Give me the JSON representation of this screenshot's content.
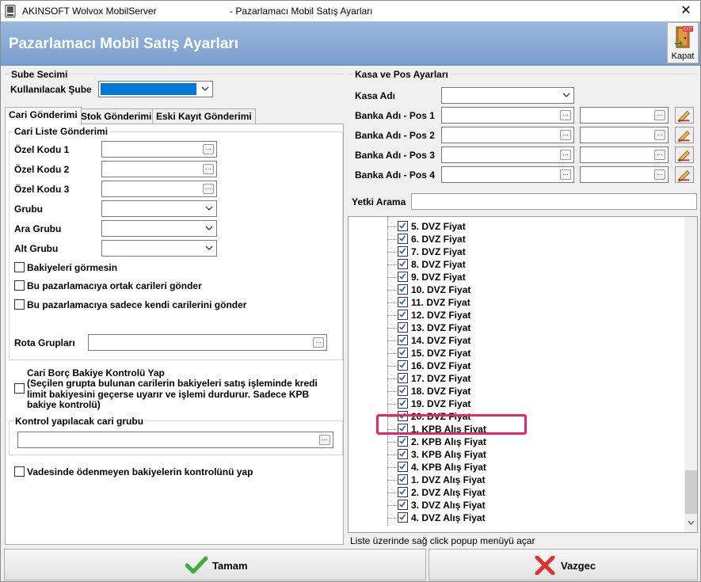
{
  "window": {
    "app_title": "AKINSOFT Wolvox MobilServer",
    "title": "- Pazarlamacı Mobil Satış Ayarları",
    "close_glyph": "✕"
  },
  "header": {
    "title": "Pazarlamacı Mobil Satış Ayarları",
    "kapat_label": "Kapat",
    "exit_badge": "EXIT"
  },
  "sube": {
    "group_label": "Sube Secimi",
    "field_label": "Kullanılacak Şube",
    "value": ""
  },
  "tabs": [
    {
      "label": "Cari Gönderimi",
      "active": true
    },
    {
      "label": "Stok Gönderimi",
      "active": false
    },
    {
      "label": "Eski Kayıt Gönderimi",
      "active": false
    }
  ],
  "cari": {
    "group_label": "Cari Liste Gönderimi",
    "fields": [
      {
        "label": "Özel Kodu 1",
        "kind": "text"
      },
      {
        "label": "Özel Kodu 2",
        "kind": "text"
      },
      {
        "label": "Özel Kodu 3",
        "kind": "text"
      },
      {
        "label": "Grubu",
        "kind": "combo"
      },
      {
        "label": "Ara Grubu",
        "kind": "combo"
      },
      {
        "label": "Alt Grubu",
        "kind": "combo"
      }
    ],
    "checks": [
      {
        "label": "Bakiyeleri görmesin",
        "checked": false
      },
      {
        "label": "Bu pazarlamacıya ortak carileri gönder",
        "checked": false
      },
      {
        "label": "Bu pazarlamacıya sadece kendi carilerini gönder",
        "checked": false
      }
    ],
    "rota_label": "Rota Grupları",
    "borc_title": "Cari Borç Bakiye Kontrolü Yap",
    "borc_desc_1": "(Seçilen grupta bulunan carilerin bakiyeleri satış işleminde kredi",
    "borc_desc_2": "limit bakiyesini geçerse uyarır ve işlemi durdurur. Sadece KPB",
    "borc_desc_3": "bakiye kontrolü)",
    "kontrol_label": "Kontrol yapılacak cari grubu",
    "vade_label": "Vadesinde ödenmeyen bakiyelerin kontrolünü yap"
  },
  "kasa": {
    "group_label": "Kasa ve Pos Ayarları",
    "kasa_label": "Kasa Adı",
    "banks": [
      "Banka Adı - Pos 1",
      "Banka Adı - Pos 2",
      "Banka Adı - Pos 3",
      "Banka Adı - Pos 4"
    ],
    "yetki_label": "Yetki Arama"
  },
  "list": {
    "items": [
      {
        "label": "5. DVZ Fiyat",
        "checked": true
      },
      {
        "label": "6. DVZ Fiyat",
        "checked": true
      },
      {
        "label": "7. DVZ Fiyat",
        "checked": true
      },
      {
        "label": "8. DVZ Fiyat",
        "checked": true
      },
      {
        "label": "9. DVZ Fiyat",
        "checked": true
      },
      {
        "label": "10. DVZ Fiyat",
        "checked": true
      },
      {
        "label": "11. DVZ Fiyat",
        "checked": true
      },
      {
        "label": "12. DVZ Fiyat",
        "checked": true
      },
      {
        "label": "13. DVZ Fiyat",
        "checked": true
      },
      {
        "label": "14. DVZ Fiyat",
        "checked": true
      },
      {
        "label": "15. DVZ Fiyat",
        "checked": true
      },
      {
        "label": "16. DVZ Fiyat",
        "checked": true
      },
      {
        "label": "17. DVZ Fiyat",
        "checked": true
      },
      {
        "label": "18. DVZ Fiyat",
        "checked": true
      },
      {
        "label": "19. DVZ Fiyat",
        "checked": true
      },
      {
        "label": "20. DVZ Fiyat",
        "checked": true
      },
      {
        "label": "1. KPB Alış Fiyat",
        "checked": true,
        "highlighted": true
      },
      {
        "label": "2. KPB Alış Fiyat",
        "checked": true
      },
      {
        "label": "3. KPB Alış Fiyat",
        "checked": true
      },
      {
        "label": "4. KPB Alış Fiyat",
        "checked": true
      },
      {
        "label": "1. DVZ Alış Fiyat",
        "checked": true
      },
      {
        "label": "2. DVZ Alış Fiyat",
        "checked": true
      },
      {
        "label": "3. DVZ Alış Fiyat",
        "checked": true
      },
      {
        "label": "4. DVZ Alış Fiyat",
        "checked": true
      }
    ],
    "status": "Liste üzerinde sağ click popup menüyü açar"
  },
  "buttons": {
    "ok": "Tamam",
    "cancel": "Vazgec"
  },
  "colors": {
    "banner": "#86a8d6",
    "selection": "#0078d7",
    "highlight": "#e8266b",
    "check": "#1f5fb6"
  }
}
